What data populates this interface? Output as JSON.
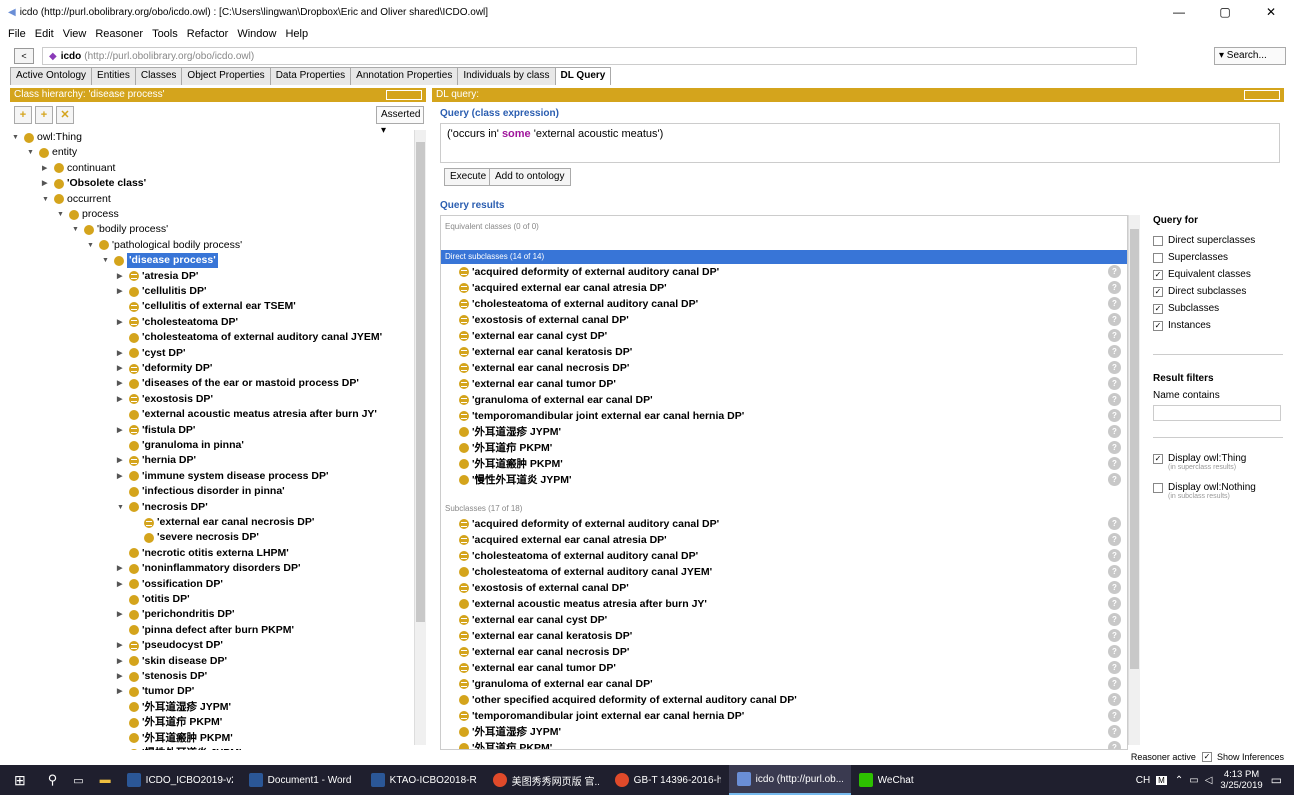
{
  "window": {
    "title": "icdo (http://purl.obolibrary.org/obo/icdo.owl) : [C:\\Users\\lingwan\\Dropbox\\Eric and Oliver shared\\ICDO.owl]",
    "minimize": "—",
    "maximize": "▢",
    "close": "✕"
  },
  "menu": [
    "File",
    "Edit",
    "View",
    "Reasoner",
    "Tools",
    "Refactor",
    "Window",
    "Help"
  ],
  "address": {
    "back": "<",
    "name": "icdo",
    "url": "(http://purl.obolibrary.org/obo/icdo.owl)",
    "search": "▾ Search..."
  },
  "tabs": [
    "Active Ontology",
    "Entities",
    "Classes",
    "Object Properties",
    "Data Properties",
    "Annotation Properties",
    "Individuals by class",
    "DL Query"
  ],
  "left_panel": {
    "header": "Class hierarchy: 'disease process'",
    "asserted": "Asserted ▾",
    "tree": [
      {
        "label": "owl:Thing",
        "depth": 0,
        "tog": "▼",
        "b": false
      },
      {
        "label": "entity",
        "depth": 1,
        "tog": "▼",
        "b": false
      },
      {
        "label": "continuant",
        "depth": 2,
        "tog": "▶",
        "b": false
      },
      {
        "label": "'Obsolete class'",
        "depth": 2,
        "tog": "▶",
        "b": true
      },
      {
        "label": "occurrent",
        "depth": 2,
        "tog": "▼",
        "b": false
      },
      {
        "label": "process",
        "depth": 3,
        "tog": "▼",
        "b": false
      },
      {
        "label": "'bodily process'",
        "depth": 4,
        "tog": "▼",
        "b": false
      },
      {
        "label": "'pathological bodily process'",
        "depth": 5,
        "tog": "▼",
        "b": false
      },
      {
        "label": "'disease process'",
        "depth": 6,
        "tog": "▼",
        "b": true,
        "sel": true
      },
      {
        "label": "'atresia DP'",
        "depth": 7,
        "tog": "▶",
        "b": true,
        "eq": true
      },
      {
        "label": "'cellulitis DP'",
        "depth": 7,
        "tog": "▶",
        "b": true
      },
      {
        "label": "'cellulitis of external ear TSEM'",
        "depth": 7,
        "tog": "",
        "b": true,
        "eq": true
      },
      {
        "label": "'cholesteatoma DP'",
        "depth": 7,
        "tog": "▶",
        "b": true,
        "eq": true
      },
      {
        "label": "'cholesteatoma of external auditory canal JYEM'",
        "depth": 7,
        "tog": "",
        "b": true
      },
      {
        "label": "'cyst DP'",
        "depth": 7,
        "tog": "▶",
        "b": true
      },
      {
        "label": "'deformity DP'",
        "depth": 7,
        "tog": "▶",
        "b": true,
        "eq": true
      },
      {
        "label": "'diseases of the ear or mastoid process DP'",
        "depth": 7,
        "tog": "▶",
        "b": true
      },
      {
        "label": "'exostosis DP'",
        "depth": 7,
        "tog": "▶",
        "b": true,
        "eq": true
      },
      {
        "label": "'external acoustic meatus atresia after burn JY'",
        "depth": 7,
        "tog": "",
        "b": true
      },
      {
        "label": "'fistula DP'",
        "depth": 7,
        "tog": "▶",
        "b": true,
        "eq": true
      },
      {
        "label": "'granuloma in pinna'",
        "depth": 7,
        "tog": "",
        "b": true
      },
      {
        "label": "'hernia DP'",
        "depth": 7,
        "tog": "▶",
        "b": true,
        "eq": true
      },
      {
        "label": "'immune system disease process DP'",
        "depth": 7,
        "tog": "▶",
        "b": true
      },
      {
        "label": "'infectious disorder in pinna'",
        "depth": 7,
        "tog": "",
        "b": true
      },
      {
        "label": "'necrosis DP'",
        "depth": 7,
        "tog": "▼",
        "b": true
      },
      {
        "label": "'external ear canal necrosis DP'",
        "depth": 8,
        "tog": "",
        "b": true,
        "eq": true
      },
      {
        "label": "'severe necrosis DP'",
        "depth": 8,
        "tog": "",
        "b": true
      },
      {
        "label": "'necrotic otitis externa LHPM'",
        "depth": 7,
        "tog": "",
        "b": true
      },
      {
        "label": "'noninflammatory disorders DP'",
        "depth": 7,
        "tog": "▶",
        "b": true
      },
      {
        "label": "'ossification DP'",
        "depth": 7,
        "tog": "▶",
        "b": true
      },
      {
        "label": "'otitis DP'",
        "depth": 7,
        "tog": "",
        "b": true
      },
      {
        "label": "'perichondritis DP'",
        "depth": 7,
        "tog": "▶",
        "b": true
      },
      {
        "label": "'pinna defect after burn PKPM'",
        "depth": 7,
        "tog": "",
        "b": true
      },
      {
        "label": "'pseudocyst DP'",
        "depth": 7,
        "tog": "▶",
        "b": true,
        "eq": true
      },
      {
        "label": "'skin disease DP'",
        "depth": 7,
        "tog": "▶",
        "b": true
      },
      {
        "label": "'stenosis DP'",
        "depth": 7,
        "tog": "▶",
        "b": true
      },
      {
        "label": "'tumor DP'",
        "depth": 7,
        "tog": "▶",
        "b": true
      },
      {
        "label": "'外耳道湿疹 JYPM'",
        "depth": 7,
        "tog": "",
        "b": true
      },
      {
        "label": "'外耳道疖 PKPM'",
        "depth": 7,
        "tog": "",
        "b": true
      },
      {
        "label": "'外耳道瘢肿 PKPM'",
        "depth": 7,
        "tog": "",
        "b": true
      },
      {
        "label": "'慢性外耳道炎 JYPM'",
        "depth": 7,
        "tog": "",
        "b": true
      }
    ]
  },
  "right_panel": {
    "header": "DL query:",
    "query_label": "Query (class expression)",
    "query_pre": "('occurs in' ",
    "query_kw": "some",
    "query_post": " 'external acoustic meatus')",
    "execute": "Execute",
    "add": "Add to ontology",
    "results_label": "Query results",
    "equiv_head": "Equivalent classes (0 of 0)",
    "direct_head": "Direct subclasses (14 of 14)",
    "direct": [
      {
        "label": "'acquired deformity of external auditory canal DP'",
        "eq": true
      },
      {
        "label": "'acquired external ear canal atresia DP'",
        "eq": true
      },
      {
        "label": "'cholesteatoma of external auditory canal DP'",
        "eq": true
      },
      {
        "label": "'exostosis of external canal DP'",
        "eq": true
      },
      {
        "label": "'external ear canal cyst DP'",
        "eq": true
      },
      {
        "label": "'external ear canal keratosis DP'",
        "eq": true
      },
      {
        "label": "'external ear canal necrosis DP'",
        "eq": true
      },
      {
        "label": "'external ear canal tumor DP'",
        "eq": true
      },
      {
        "label": "'granuloma  of external ear canal DP'",
        "eq": true
      },
      {
        "label": "'temporomandibular joint  external ear canal   hernia DP'",
        "eq": true
      },
      {
        "label": "'外耳道湿疹 JYPM'",
        "eq": false
      },
      {
        "label": "'外耳道疖 PKPM'",
        "eq": false
      },
      {
        "label": "'外耳道瘢肿 PKPM'",
        "eq": false
      },
      {
        "label": "'慢性外耳道炎 JYPM'",
        "eq": false
      }
    ],
    "sub_head": "Subclasses (17 of 18)",
    "sub": [
      {
        "label": "'acquired deformity of external auditory canal DP'",
        "eq": true
      },
      {
        "label": "'acquired external ear canal atresia DP'",
        "eq": true
      },
      {
        "label": "'cholesteatoma of external auditory canal DP'",
        "eq": true
      },
      {
        "label": "'cholesteatoma of external auditory canal JYEM'",
        "eq": false
      },
      {
        "label": "'exostosis of external canal DP'",
        "eq": true
      },
      {
        "label": "'external acoustic meatus atresia after burn JY'",
        "eq": false
      },
      {
        "label": "'external ear canal cyst DP'",
        "eq": true
      },
      {
        "label": "'external ear canal keratosis DP'",
        "eq": true
      },
      {
        "label": "'external ear canal necrosis DP'",
        "eq": true
      },
      {
        "label": "'external ear canal tumor DP'",
        "eq": true
      },
      {
        "label": "'granuloma  of external ear canal DP'",
        "eq": true
      },
      {
        "label": "'other specified acquired deformity of external auditory canal DP'",
        "eq": false
      },
      {
        "label": "'temporomandibular joint  external ear canal   hernia DP'",
        "eq": true
      },
      {
        "label": "'外耳道湿疹 JYPM'",
        "eq": false
      },
      {
        "label": "'外耳道疖 PKPM'",
        "eq": false
      }
    ],
    "help_glyph": "?"
  },
  "side": {
    "query_for": "Query for",
    "options": [
      {
        "label": "Direct superclasses",
        "checked": false
      },
      {
        "label": "Superclasses",
        "checked": false
      },
      {
        "label": "Equivalent classes",
        "checked": true
      },
      {
        "label": "Direct subclasses",
        "checked": true
      },
      {
        "label": "Subclasses",
        "checked": true
      },
      {
        "label": "Instances",
        "checked": true
      }
    ],
    "filters": "Result filters",
    "name_contains": "Name contains",
    "disp_thing": "Display owl:Thing",
    "disp_thing_sub": "(in superclass results)",
    "disp_nothing": "Display owl:Nothing",
    "disp_nothing_sub": "(in subclass results)"
  },
  "status": {
    "reasoner": "Reasoner active",
    "show_inf": "Show Inferences"
  },
  "taskbar": {
    "items": [
      "ICDO_ICBO2019-v2...",
      "Document1 - Word",
      "KTAO-ICBO2018-R...",
      "美图秀秀网页版 官...",
      "GB-T 14396-2016-h...",
      "icdo (http://purl.ob...",
      "WeChat"
    ],
    "lang": "CH",
    "time": "4:13 PM",
    "date": "3/25/2019"
  }
}
